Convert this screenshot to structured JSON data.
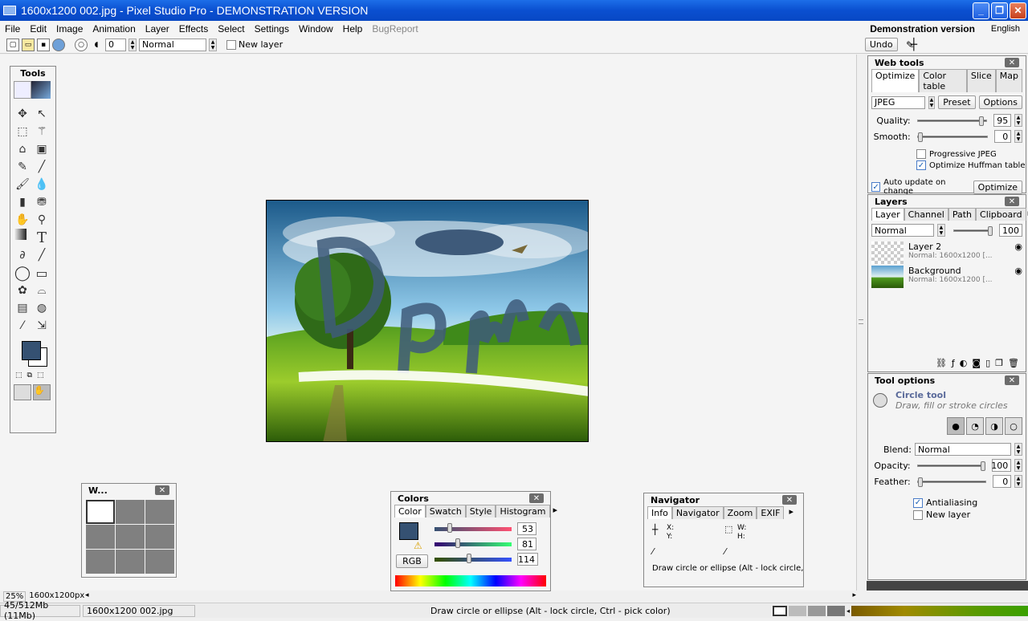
{
  "window": {
    "title": "1600x1200 002.jpg - Pixel Studio Pro - DEMONSTRATION VERSION"
  },
  "menu": {
    "items": [
      "File",
      "Edit",
      "Image",
      "Animation",
      "Layer",
      "Effects",
      "Select",
      "Settings",
      "Window",
      "Help"
    ],
    "disabled_item": "BugReport",
    "demo": "Demonstration version",
    "language": "English"
  },
  "toolbar": {
    "size_value": "0",
    "blend": "Normal",
    "new_layer": "New layer",
    "undo": "Undo"
  },
  "tools": {
    "title": "Tools"
  },
  "web_tools": {
    "title": "Web tools",
    "tabs": [
      "Optimize",
      "Color table",
      "Slice",
      "Map"
    ],
    "format": "JPEG",
    "preset": "Preset",
    "options": "Options",
    "quality_label": "Quality:",
    "quality": "95",
    "quality_level": 0.95,
    "smooth_label": "Smooth:",
    "smooth": "0",
    "smooth_level": 0.0,
    "progressive": "Progressive JPEG",
    "huffman": "Optimize Huffman table",
    "auto_update": "Auto update on change",
    "optimize_btn": "Optimize"
  },
  "layers": {
    "title": "Layers",
    "tabs": [
      "Layer",
      "Channel",
      "Path",
      "Clipboard"
    ],
    "blend": "Normal",
    "opacity": "100",
    "items": [
      {
        "name": "Layer 2",
        "info": "Normal: 1600x1200 [..."
      },
      {
        "name": "Background",
        "info": "Normal: 1600x1200 [..."
      }
    ]
  },
  "tool_options": {
    "title": "Tool options",
    "tool_name": "Circle tool",
    "tool_desc": "Draw, fill or stroke circles",
    "blend_label": "Blend:",
    "blend": "Normal",
    "opacity_label": "Opacity:",
    "opacity": "100",
    "opacity_level": 1.0,
    "feather_label": "Feather:",
    "feather": "0",
    "feather_level": 0.0,
    "antialiasing": "Antialiasing",
    "new_layer": "New layer"
  },
  "small_panel": {
    "title": "W..."
  },
  "colors": {
    "title": "Colors",
    "tabs": [
      "Color",
      "Swatch",
      "Style",
      "Histogram"
    ],
    "r": "53",
    "g": "81",
    "b": "114",
    "mode": "RGB",
    "swatch_color": "#355172"
  },
  "navigator": {
    "title": "Navigator",
    "tabs": [
      "Info",
      "Navigator",
      "Zoom",
      "EXIF"
    ],
    "x_label": "X:",
    "y_label": "Y:",
    "w_label": "W:",
    "h_label": "H:",
    "hint": "Draw circle or ellipse (Alt - lock circle,"
  },
  "zoom": {
    "value": "25%",
    "size": "1600x1200px"
  },
  "status": {
    "memory": "45/512Mb (11Mb)",
    "file": "1600x1200 002.jpg",
    "hint": "Draw circle or ellipse (Alt - lock circle, Ctrl - pick color)"
  }
}
